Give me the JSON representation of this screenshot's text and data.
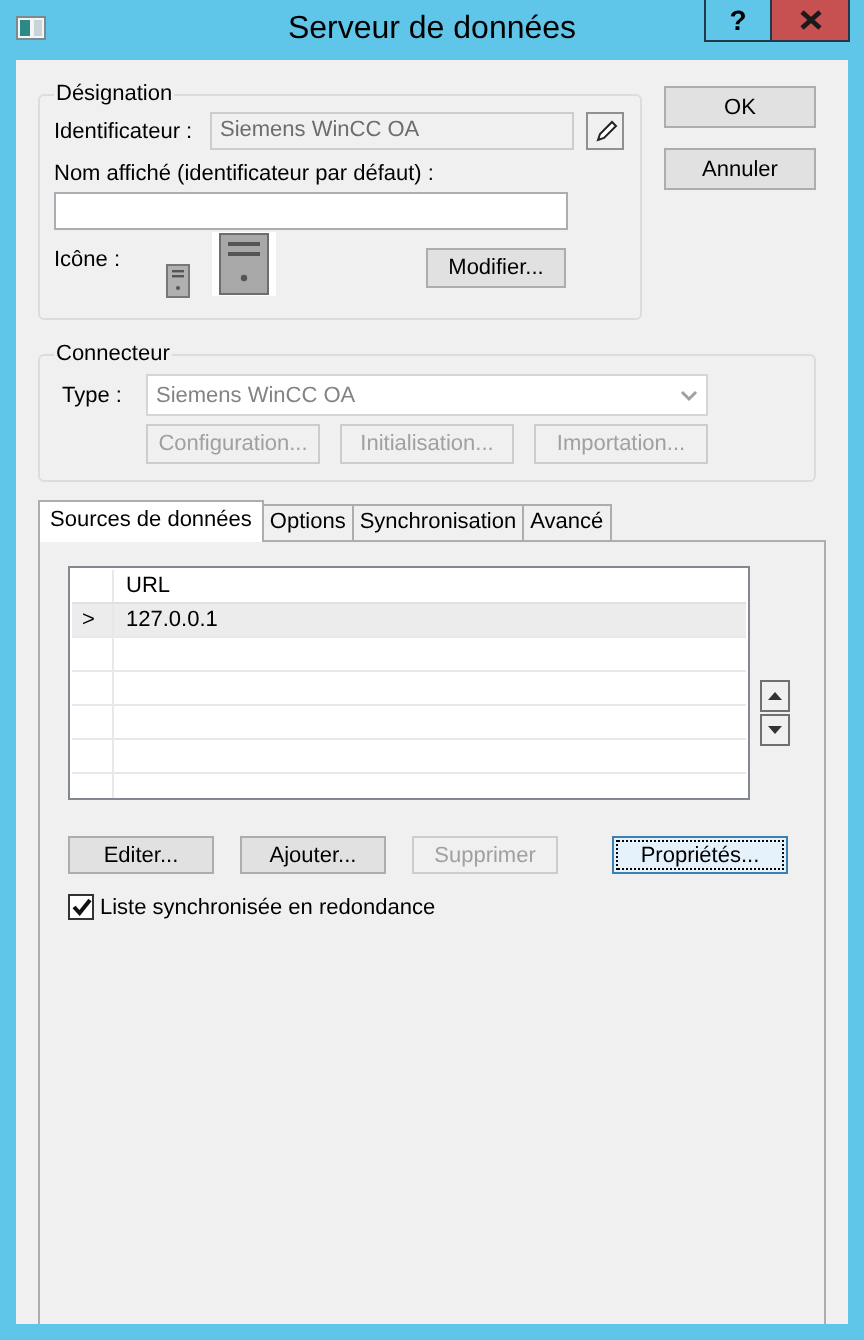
{
  "window": {
    "title": "Serveur de données",
    "help_button": "?"
  },
  "designation": {
    "legend": "Désignation",
    "identifier_label": "Identificateur :",
    "identifier_value": "Siemens WinCC OA",
    "display_name_label": "Nom affiché (identificateur par défaut) :",
    "icon_label": "Icône :",
    "modify_button": "Modifier..."
  },
  "dialog_buttons": [
    {
      "label": "OK"
    },
    {
      "label": "Annuler"
    }
  ],
  "connector": {
    "legend": "Connecteur",
    "type_label": "Type :",
    "type_value": "Siemens WinCC OA",
    "buttons": [
      {
        "label": "Configuration...",
        "disabled": true
      },
      {
        "label": "Initialisation...",
        "disabled": true
      },
      {
        "label": "Importation...",
        "disabled": true
      }
    ]
  },
  "tabs": [
    {
      "label": "Sources de données",
      "selected": true
    },
    {
      "label": "Options",
      "selected": false
    },
    {
      "label": "Synchronisation",
      "selected": false
    },
    {
      "label": "Avancé",
      "selected": false
    }
  ],
  "grid": {
    "columns": [
      "URL"
    ],
    "rows": [
      {
        "indicator": ">",
        "url": "127.0.0.1",
        "selected": true
      }
    ]
  },
  "action_buttons": [
    {
      "label": "Editer...",
      "disabled": false,
      "focused": false
    },
    {
      "label": "Ajouter...",
      "disabled": false,
      "focused": false
    },
    {
      "label": "Supprimer",
      "disabled": true,
      "focused": false
    },
    {
      "label": "Propriétés...",
      "disabled": false,
      "focused": true
    }
  ],
  "redundancy_checkbox": {
    "label": "Liste synchronisée en redondance",
    "checked": true
  }
}
